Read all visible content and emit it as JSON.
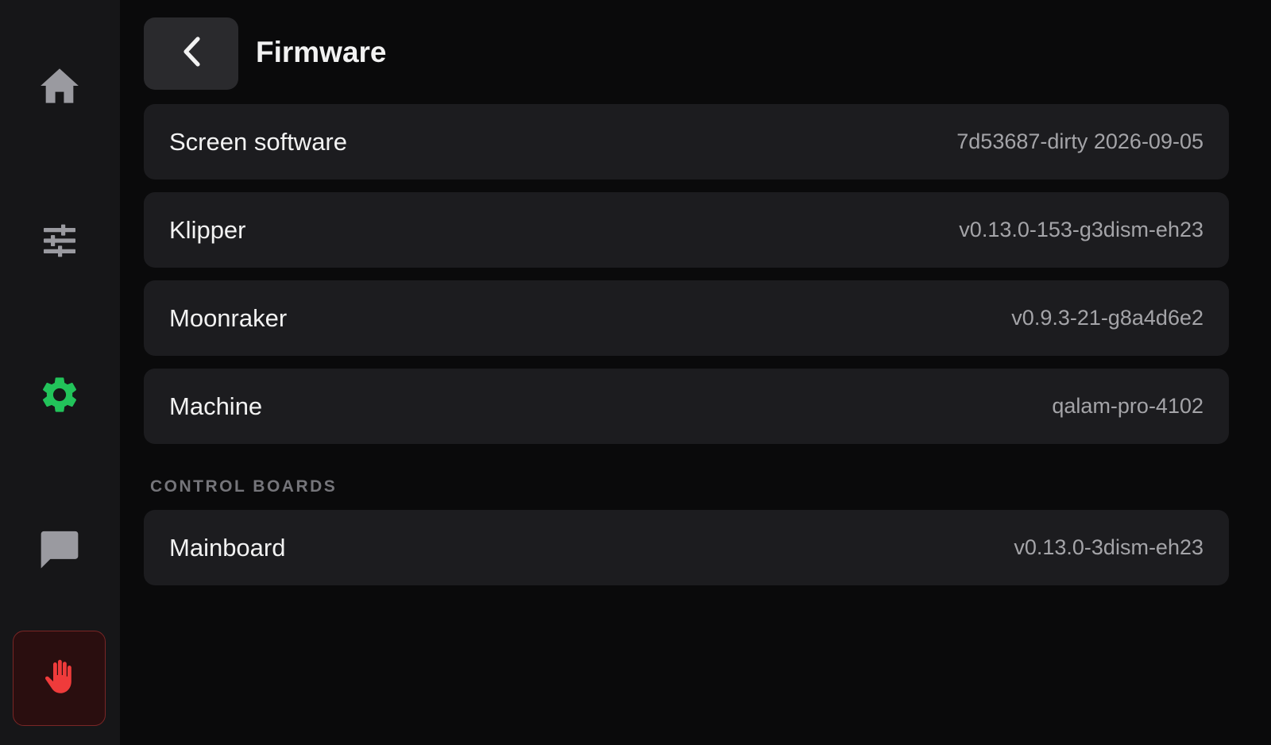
{
  "colors": {
    "background": "#0a0a0b",
    "sidebar": "#161618",
    "row": "#1c1c1f",
    "active_accent": "#22c35a",
    "icon_inactive": "#9a9aa0",
    "estop_red": "#ef3b3b"
  },
  "sidebar": {
    "items": [
      {
        "icon": "home-icon",
        "active": false
      },
      {
        "icon": "tune-icon",
        "active": false
      },
      {
        "icon": "gear-icon",
        "active": true
      },
      {
        "icon": "message-icon",
        "active": false
      }
    ],
    "estop_icon": "hand-stop-icon"
  },
  "header": {
    "back_icon": "chevron-left-icon",
    "title": "Firmware"
  },
  "firmware": {
    "rows": [
      {
        "label": "Screen software",
        "value": "7d53687-dirty 2026-09-05"
      },
      {
        "label": "Klipper",
        "value": "v0.13.0-153-g3dism-eh23"
      },
      {
        "label": "Moonraker",
        "value": "v0.9.3-21-g8a4d6e2"
      },
      {
        "label": "Machine",
        "value": "qalam-pro-4102"
      }
    ]
  },
  "control_boards": {
    "header": "CONTROL BOARDS",
    "rows": [
      {
        "label": "Mainboard",
        "value": "v0.13.0-3dism-eh23"
      }
    ]
  }
}
